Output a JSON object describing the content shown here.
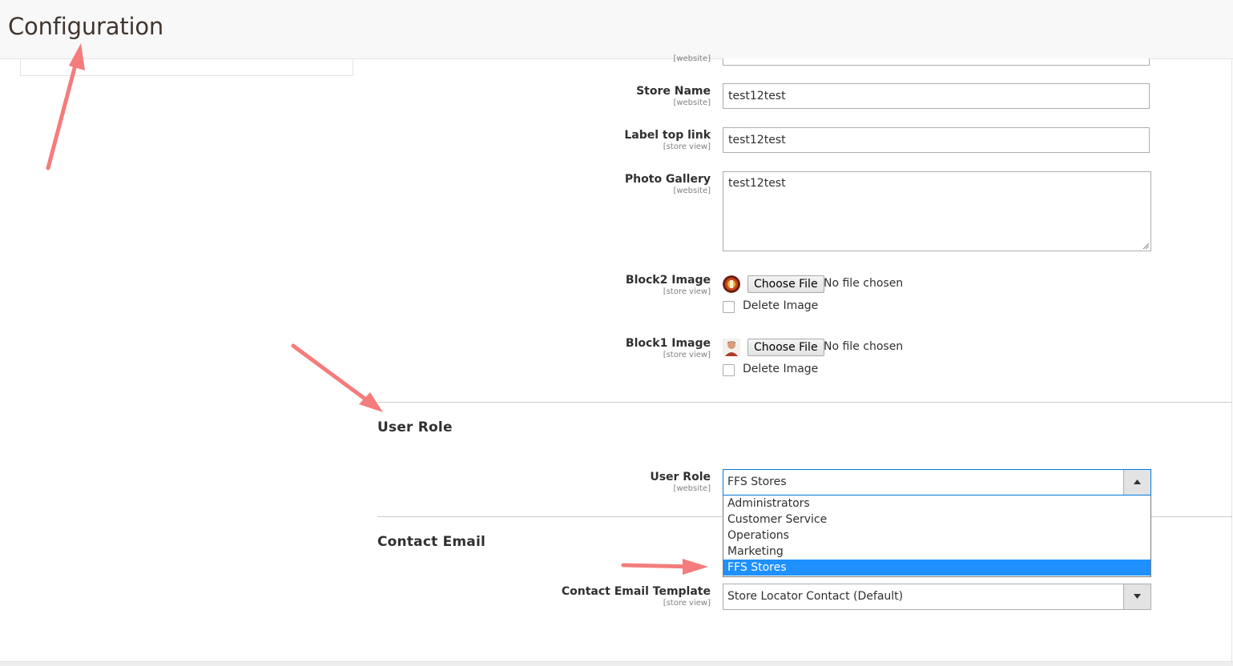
{
  "header": {
    "title": "Configuration"
  },
  "fields": {
    "top_scope": "[website]",
    "store_name": {
      "label": "Store Name",
      "scope": "[website]",
      "value": "test12test"
    },
    "label_top_link": {
      "label": "Label top link",
      "scope": "[store view]",
      "value": "test12test"
    },
    "photo_gallery": {
      "label": "Photo Gallery",
      "scope": "[website]",
      "value": "test12test"
    },
    "block2_image": {
      "label": "Block2 Image",
      "scope": "[store view]",
      "button": "Choose File",
      "status": "No file chosen",
      "delete_label": "Delete Image",
      "thumb_icon": "circular-photo-icon"
    },
    "block1_image": {
      "label": "Block1 Image",
      "scope": "[store view]",
      "button": "Choose File",
      "status": "No file chosen",
      "delete_label": "Delete Image",
      "thumb_icon": "portrait-photo-icon"
    }
  },
  "user_role_section": {
    "title": "User Role",
    "field": {
      "label": "User Role",
      "scope": "[website]",
      "value": "FFS Stores"
    },
    "options": [
      "Administrators",
      "Customer Service",
      "Operations",
      "Marketing",
      "FFS Stores"
    ],
    "selected_index": 4
  },
  "contact_email_section": {
    "title": "Contact Email",
    "field": {
      "label": "Contact Email Template",
      "scope": "[store view]",
      "value": "Store Locator Contact (Default)"
    }
  },
  "colors": {
    "selected_option": "#1e90ff",
    "annotation_arrow": "#f47c7c",
    "focus_border": "#007bdb"
  }
}
